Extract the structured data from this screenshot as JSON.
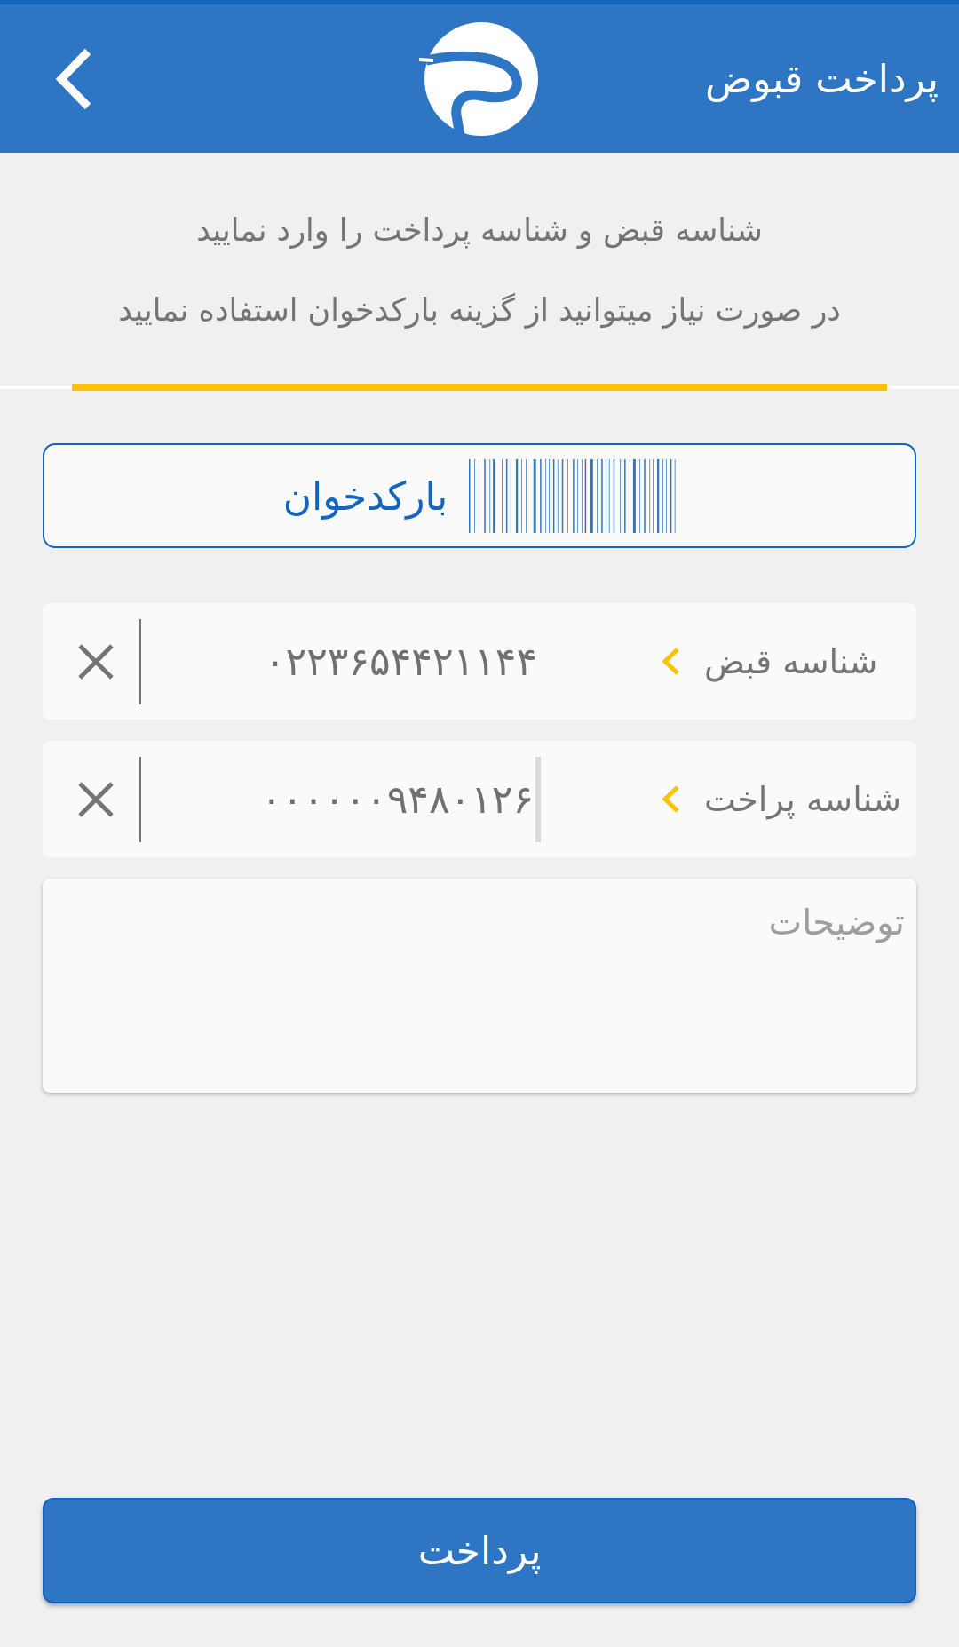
{
  "header": {
    "title": "پرداخت قبوض"
  },
  "instructions": [
    "شناسه قبض و شناسه پرداخت را وارد نمایید",
    "در صورت نیاز میتوانید از گزینه بارکدخوان استفاده نمایید"
  ],
  "barcode_button": {
    "label": "بارکدخوان"
  },
  "fields": [
    {
      "label": "شناسه قبض",
      "value": "۰۲۲۳۶۵۴۴۲۱۱۴۴",
      "focused": false
    },
    {
      "label": "شناسه پراخت",
      "value": "۰۰۰۰۰۰۹۴۸۰۱۲۶",
      "focused": true
    }
  ],
  "description": {
    "placeholder": "توضیحات"
  },
  "submit_button": {
    "label": "پرداخت"
  }
}
